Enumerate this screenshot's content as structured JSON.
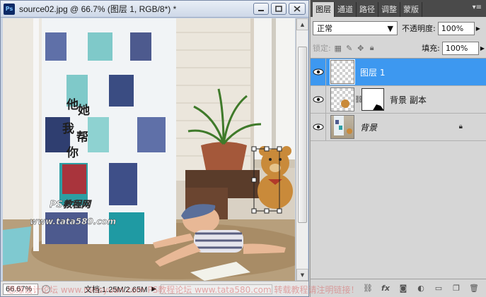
{
  "window": {
    "title": "source02.jpg @ 66.7% (图层 1, RGB/8*) *",
    "icon": "photoshop-icon"
  },
  "canvas": {
    "calligraphy": [
      "他",
      "她",
      "我",
      "帮",
      "你"
    ],
    "logo_line1": "PS教程网",
    "logo_line2": "www.tata580.com"
  },
  "status": {
    "zoom": "66.67%",
    "doc_info": "文档:1.25M/2.65M"
  },
  "panel": {
    "tabs": [
      "图层",
      "通道",
      "路径",
      "调整",
      "蒙版"
    ],
    "active_tab": 0,
    "blend_mode": "正常",
    "opacity_label": "不透明度:",
    "opacity_value": "100%",
    "lock_label": "锁定:",
    "fill_label": "填充:",
    "fill_value": "100%"
  },
  "layers": [
    {
      "name": "图层 1",
      "selected": true,
      "visible": true
    },
    {
      "name": "背景 副本",
      "selected": false,
      "visible": true,
      "has_mask": true
    },
    {
      "name": "背景",
      "selected": false,
      "visible": true,
      "locked": true
    }
  ],
  "footer_icons": [
    "link-icon",
    "fx-icon",
    "mask-icon",
    "adjustment-icon",
    "folder-icon",
    "new-layer-icon",
    "trash-icon"
  ],
  "watermark": "思缘设计论坛 www.missyuan.com   PS教程论坛 www.tata580.com   转载教程请注明链接！",
  "colors": {
    "selected_layer": "#3d98f0",
    "panel_tab_bar": "#4a4a4a"
  }
}
